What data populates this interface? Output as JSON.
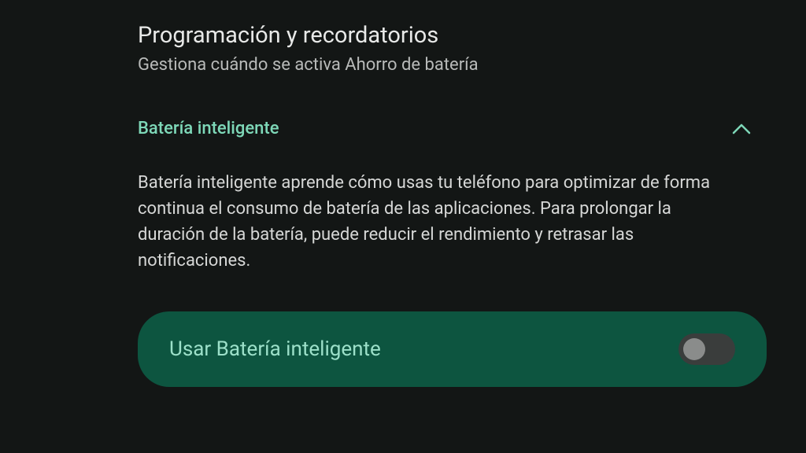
{
  "header": {
    "title": "Programación y recordatorios",
    "subtitle": "Gestiona cuándo se activa Ahorro de batería"
  },
  "section": {
    "title": "Batería inteligente",
    "description": "Batería inteligente aprende cómo usas tu teléfono para optimizar de forma continua el consumo de batería de las aplicaciones. Para prolongar la duración de la batería, puede reducir el rendimiento y retrasar las notificaciones."
  },
  "toggle": {
    "label": "Usar Batería inteligente",
    "state": "off"
  },
  "colors": {
    "accent": "#7ed8b8",
    "toggleBg": "#0d5540"
  }
}
